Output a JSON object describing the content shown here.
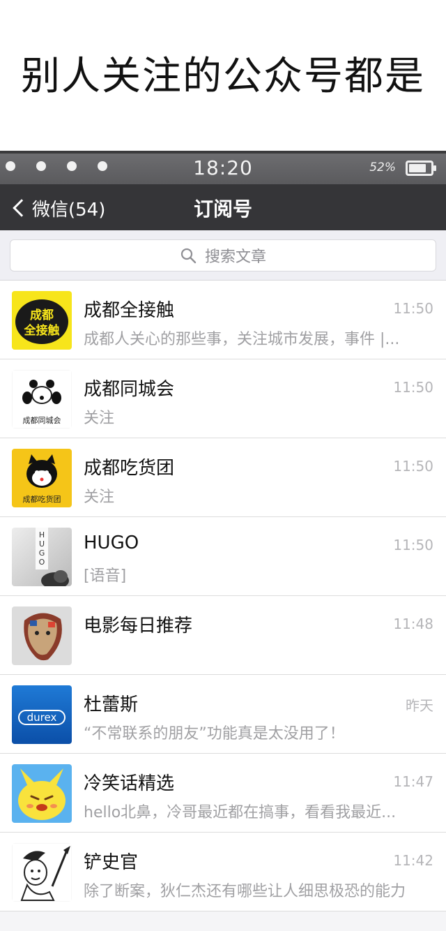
{
  "caption": "别人关注的公众号都是",
  "status_bar": {
    "time": "18:20",
    "battery": "52%"
  },
  "nav": {
    "back_label": "微信(54)",
    "title": "订阅号"
  },
  "search": {
    "placeholder": "搜索文章"
  },
  "accounts": [
    {
      "name": "成都全接触",
      "time": "11:50",
      "preview": "成都人关心的那些事，关注城市发展，事件 |...",
      "avatar_text": "成都全接触"
    },
    {
      "name": "成都同城会",
      "time": "11:50",
      "preview": "关注",
      "avatar_text": "成都同城会"
    },
    {
      "name": "成都吃货团",
      "time": "11:50",
      "preview": "关注",
      "avatar_text": "成都吃货团"
    },
    {
      "name": "HUGO",
      "time": "11:50",
      "preview": "[语音]",
      "avatar_text": "HUGO"
    },
    {
      "name": "电影每日推荐",
      "time": "11:48",
      "preview": ""
    },
    {
      "name": "杜蕾斯",
      "time": "昨天",
      "preview": "“不常联系的朋友”功能真是太没用了！",
      "avatar_text": "durex"
    },
    {
      "name": "冷笑话精选",
      "time": "11:47",
      "preview": "hello北鼻，冷哥最近都在搞事，看看我最近..."
    },
    {
      "name": "铲史官",
      "time": "11:42",
      "preview": "除了断案，狄仁杰还有哪些让人细思极恐的能力"
    }
  ]
}
